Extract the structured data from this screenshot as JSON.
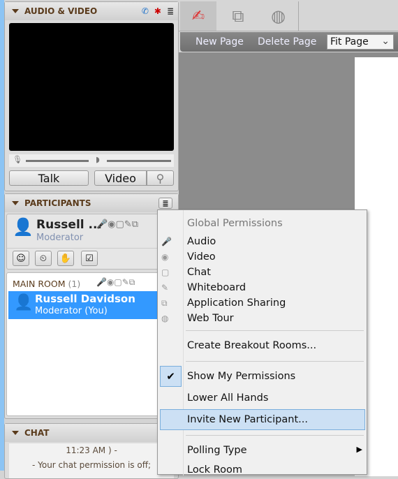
{
  "audio_video": {
    "title": "AUDIO & VIDEO",
    "talk": "Talk",
    "video": "Video"
  },
  "participants": {
    "title": "PARTICIPANTS",
    "me_name": "Russell ...",
    "me_role": "Moderator",
    "room_label": "MAIN ROOM",
    "room_count": "(1)",
    "list": [
      {
        "name": "Russell Davidson",
        "role": "Moderator (You)"
      }
    ]
  },
  "chat": {
    "title": "CHAT",
    "lines": [
      "11:23 AM ) -",
      "- Your chat permission is off;"
    ]
  },
  "toolbar": {
    "new_page": "New Page",
    "delete_page": "Delete Page",
    "zoom_select": "Fit Page"
  },
  "menu": {
    "header": "Global Permissions",
    "permissions": [
      "Audio",
      "Video",
      "Chat",
      "Whiteboard",
      "Application Sharing",
      "Web Tour"
    ],
    "create_breakout": "Create Breakout Rooms...",
    "show_perms": "Show My Permissions",
    "lower_hands": "Lower All Hands",
    "invite": "Invite New Participant...",
    "polling": "Polling Type",
    "lock": "Lock Room"
  },
  "colors": {
    "selected_row": "#3399ff",
    "menu_highlight": "#cce0f4",
    "header_text": "#5a3b1c"
  }
}
